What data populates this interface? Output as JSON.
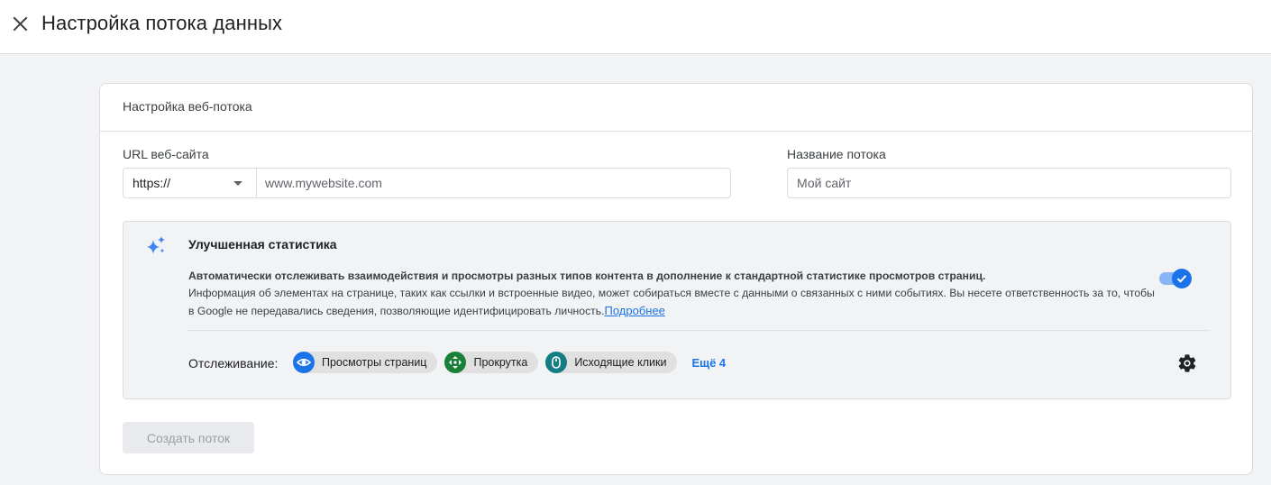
{
  "header": {
    "title": "Настройка потока данных"
  },
  "card": {
    "title": "Настройка веб-потока",
    "url": {
      "label": "URL веб-сайта",
      "protocol": "https://",
      "placeholder": "www.mywebsite.com",
      "value": ""
    },
    "stream_name": {
      "label": "Название потока",
      "placeholder": "Мой сайт",
      "value": ""
    },
    "enhanced": {
      "title": "Улучшенная статистика",
      "description_bold": "Автоматически отслеживать взаимодействия и просмотры разных типов контента в дополнение к стандартной статистике просмотров страниц.",
      "description": "Информация об элементах на странице, таких как ссылки и встроенные видео, может собираться вместе с данными о связанных с ними событиях. Вы несете ответственность за то, чтобы в Google не передавались сведения, позволяющие идентифицировать личность.",
      "link": "Подробнее",
      "enabled": true,
      "tracking_label": "Отслеживание:",
      "chips": [
        {
          "label": "Просмотры страниц",
          "icon": "eye-icon",
          "color": "#1a73e8"
        },
        {
          "label": "Прокрутка",
          "icon": "scroll-arrows-icon",
          "color": "#188038"
        },
        {
          "label": "Исходящие клики",
          "icon": "mouse-icon",
          "color": "#137d83"
        }
      ],
      "more": "Ещё 4"
    },
    "create_button": "Создать поток"
  },
  "colors": {
    "accent": "#1a73e8",
    "toggle_track": "#8ab4f8",
    "panel_bg": "#f1f3f4",
    "border": "#dadce0"
  }
}
